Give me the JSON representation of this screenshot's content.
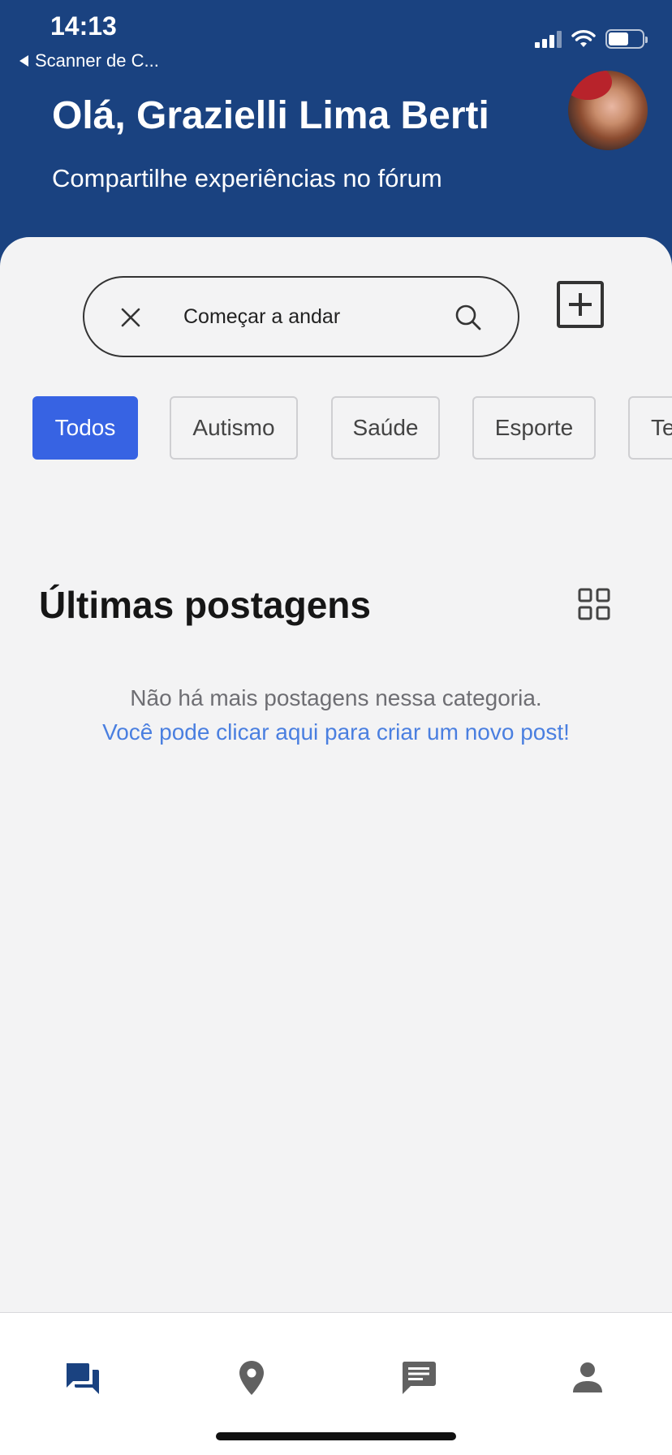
{
  "status_bar": {
    "time": "14:13",
    "back_app": "Scanner de C..."
  },
  "header": {
    "greeting": "Olá, Grazielli Lima Berti",
    "subtitle": "Compartilhe experiências no fórum"
  },
  "search": {
    "value": "Começar a andar"
  },
  "categories": [
    "Todos",
    "Autismo",
    "Saúde",
    "Esporte",
    "Te"
  ],
  "active_category": "Todos",
  "posts_section": {
    "title": "Últimas postagens",
    "empty_message": "Não há mais postagens nessa categoria.",
    "create_link": "Você pode clicar aqui para criar um novo post!"
  },
  "tabbar": {
    "items": [
      "forum-icon",
      "map-pin-icon",
      "chat-icon",
      "profile-icon"
    ],
    "active": "forum-icon"
  },
  "colors": {
    "header_bg": "#1a4280",
    "accent": "#3763e3",
    "link": "#4a7fe0",
    "active_tab": "#1a4280",
    "inactive_tab": "#616161"
  }
}
